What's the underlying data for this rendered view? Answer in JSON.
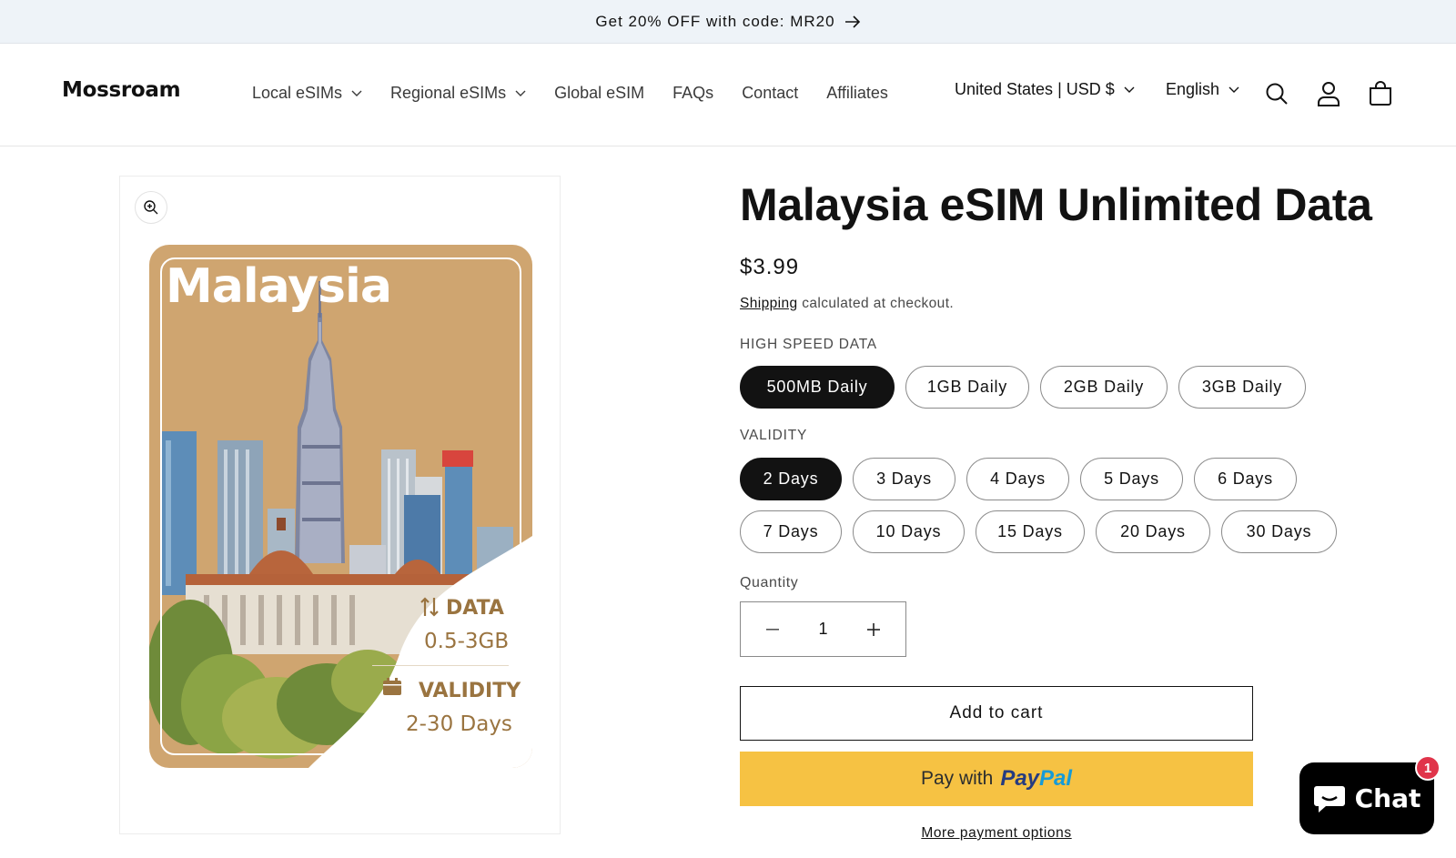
{
  "announcement": {
    "text": "Get 20% OFF with code: MR20"
  },
  "header": {
    "logo": "Mossroam",
    "nav": [
      {
        "label": "Local eSIMs",
        "has_dropdown": true
      },
      {
        "label": "Regional eSIMs",
        "has_dropdown": true
      },
      {
        "label": "Global eSIM",
        "has_dropdown": false
      },
      {
        "label": "FAQs",
        "has_dropdown": false
      },
      {
        "label": "Contact",
        "has_dropdown": false
      },
      {
        "label": "Affiliates",
        "has_dropdown": false
      }
    ],
    "locale": "United States | USD $",
    "language": "English",
    "icons": [
      "search-icon",
      "account-icon",
      "cart-icon"
    ]
  },
  "media": {
    "zoom_icon": "zoom-in-icon",
    "card": {
      "title": "Malaysia",
      "data_label": "DATA",
      "data_value": "0.5-3GB",
      "validity_label": "VALIDITY",
      "validity_value": "2-30 Days"
    }
  },
  "product": {
    "title": "Malaysia eSIM Unlimited Data",
    "price": "$3.99",
    "shipping_link": "Shipping",
    "shipping_text": " calculated at checkout.",
    "data_label": "HIGH SPEED DATA",
    "data_options": [
      "500MB Daily",
      "1GB Daily",
      "2GB Daily",
      "3GB Daily"
    ],
    "data_selected": "500MB Daily",
    "validity_label": "VALIDITY",
    "validity_options_row1": [
      "2 Days",
      "3 Days",
      "4 Days",
      "5 Days",
      "6 Days"
    ],
    "validity_options_row2": [
      "7 Days",
      "10 Days",
      "15 Days",
      "20 Days",
      "30 Days"
    ],
    "validity_selected": "2 Days",
    "quantity_label": "Quantity",
    "quantity_value": "1",
    "add_to_cart": "Add to cart",
    "paypal_prefix": "Pay with",
    "paypal_brand_1": "Pay",
    "paypal_brand_2": "Pal",
    "more_payment": "More payment options"
  },
  "chat": {
    "label": "Chat",
    "badge": "1"
  },
  "colors": {
    "card_bg": "#cfa570",
    "paypal_yellow": "#f6c243",
    "selected_pill": "#121212",
    "badge_red": "#e0344a"
  }
}
